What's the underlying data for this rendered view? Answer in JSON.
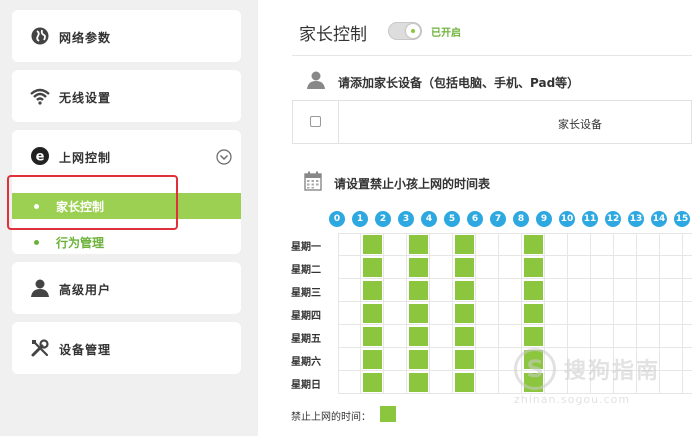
{
  "sidebar": {
    "items": [
      {
        "label": "网络参数",
        "icon": "globe-icon"
      },
      {
        "label": "无线设置",
        "icon": "wifi-icon"
      },
      {
        "label": "上网控制",
        "icon": "ie-icon"
      },
      {
        "label": "高级用户",
        "icon": "user-icon"
      },
      {
        "label": "设备管理",
        "icon": "tools-icon"
      }
    ],
    "subitems": [
      {
        "label": "家长控制",
        "active": true
      },
      {
        "label": "行为管理",
        "active": false
      }
    ]
  },
  "main": {
    "title": "家长控制",
    "toggle_status": "已开启",
    "toggle_on": true,
    "device_section_title": "请添加家长设备（包括电脑、手机、Pad等）",
    "device_table_header": "家长设备",
    "schedule_section_title": "请设置禁止小孩上网的时间表",
    "hours": [
      "0",
      "1",
      "2",
      "3",
      "4",
      "5",
      "6",
      "7",
      "8",
      "9",
      "10",
      "11",
      "12",
      "13",
      "14",
      "15"
    ],
    "days": [
      "星期一",
      "星期二",
      "星期三",
      "星期四",
      "星期五",
      "星期六",
      "星期日"
    ],
    "blocked_hours": [
      1,
      3,
      5,
      8
    ],
    "legend_label": "禁止上网的时间："
  },
  "colors": {
    "accent_green": "#8cc63f",
    "hour_blue": "#2ea8e0",
    "highlight_red": "#e0303c"
  },
  "watermark": {
    "logo": "S",
    "text": "搜狗指南",
    "sub": "zhinan.sogou.com"
  }
}
